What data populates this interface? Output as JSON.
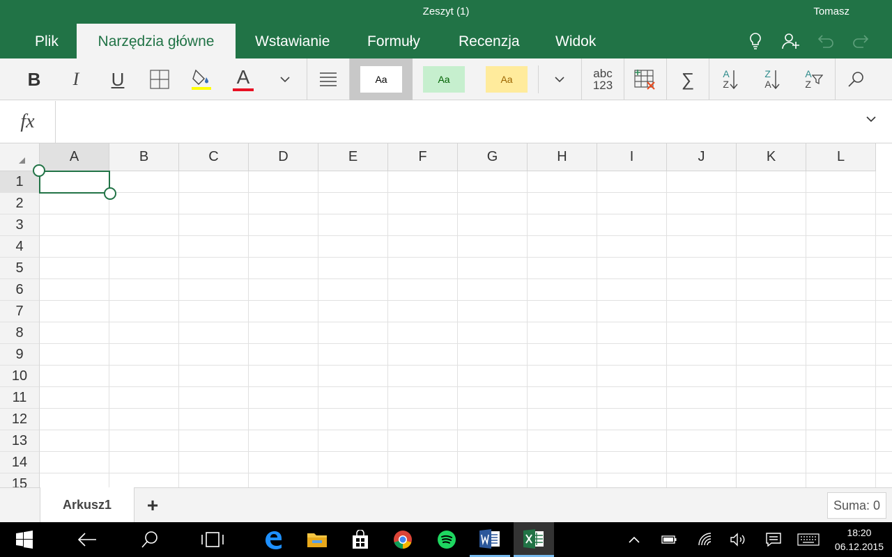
{
  "window": {
    "title": "Zeszyt (1)",
    "user": "Tomasz"
  },
  "tabs": [
    {
      "label": "Plik"
    },
    {
      "label": "Narzędzia główne"
    },
    {
      "label": "Wstawianie"
    },
    {
      "label": "Formuły"
    },
    {
      "label": "Recenzja"
    },
    {
      "label": "Widok"
    }
  ],
  "ribbon": {
    "bold": "B",
    "italic": "I",
    "underline": "U",
    "font_color_letter": "A",
    "style_normal": "Aa",
    "style_good": "Aa",
    "style_neutral": "Aa",
    "number_format_top": "abc",
    "number_format_bottom": "123",
    "autosum": "∑",
    "sort_asc_top": "A",
    "sort_asc_bottom": "Z",
    "sort_desc_top": "Z",
    "sort_desc_bottom": "A",
    "filter_top": "A",
    "filter_bottom": "Z"
  },
  "formula_bar": {
    "fx_label": "fx",
    "value": ""
  },
  "grid": {
    "columns": [
      "A",
      "B",
      "C",
      "D",
      "E",
      "F",
      "G",
      "H",
      "I",
      "J",
      "K",
      "L"
    ],
    "rows": [
      "1",
      "2",
      "3",
      "4",
      "5",
      "6",
      "7",
      "8",
      "9",
      "10",
      "11",
      "12",
      "13",
      "14",
      "15"
    ],
    "selected_cell": "A1"
  },
  "sheets": [
    {
      "label": "Arkusz1"
    }
  ],
  "add_sheet_label": "+",
  "status": {
    "sum": "Suma: 0"
  },
  "colors": {
    "accent": "#217346",
    "highlight_yellow": "#ffff00",
    "font_red": "#e81123"
  },
  "taskbar": {
    "time": "18:20",
    "date": "06.12.2015"
  }
}
